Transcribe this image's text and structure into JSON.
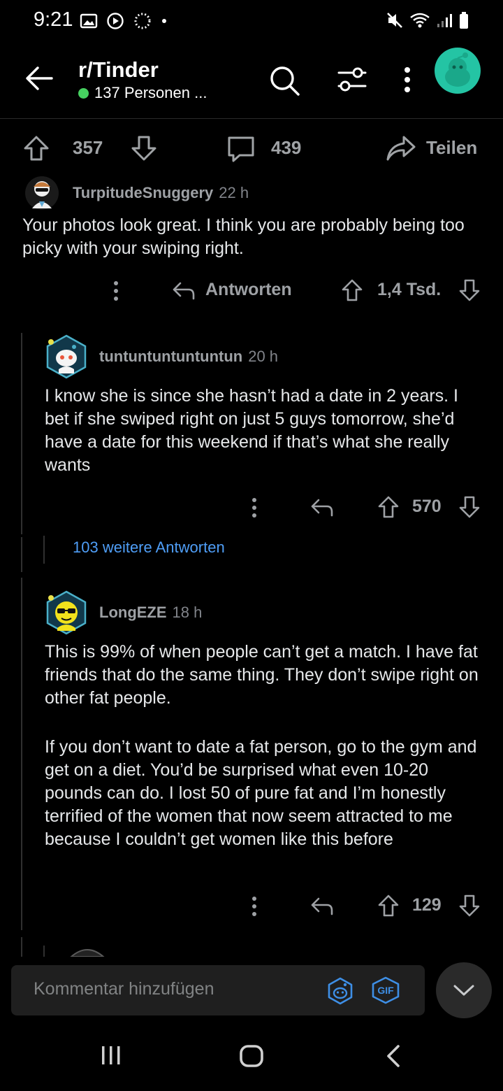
{
  "status": {
    "time": "9:21",
    "left_icons": [
      "image-icon",
      "play-icon",
      "spinner-icon",
      "dot-icon"
    ],
    "right_icons": [
      "mute-icon",
      "wifi-icon",
      "signal-icon",
      "battery-icon"
    ]
  },
  "header": {
    "title": "r/Tinder",
    "online_text": "137 Personen ...",
    "online_color": "#46d160",
    "avatar_color": "#24c4a4"
  },
  "post_bar": {
    "upvotes": "357",
    "comments": "439",
    "share_label": "Teilen"
  },
  "comments": [
    {
      "user": "TurpitudeSnuggery",
      "time": "22 h",
      "body": [
        "Your photos look great. I think you are probably being too picky with your swiping right."
      ],
      "reply_label": "Antworten",
      "score": "1,4 Tsd."
    },
    {
      "user": "tuntuntuntuntuntun",
      "time": "20 h",
      "body": [
        "I know she is since she hasn’t had a date in 2 years. I bet if she swiped right on just 5 guys tomorrow, she’d have a date for this weekend if that’s what she really wants"
      ],
      "score": "570"
    },
    {
      "user": "LongEZE",
      "time": "18 h",
      "body": [
        "This is 99% of when people can’t get a match. I have fat friends that do the same thing. They don’t swipe right on other fat people.",
        "If you don’t want to date a fat person, go to the gym and get on a diet. You’d be surprised what even 10-20 pounds can do. I lost 50 of pure fat and I’m honestly terrified of the women that now seem attracted to me because I couldn’t get women like this before"
      ],
      "score": "129"
    }
  ],
  "more_replies": "103 weitere Antworten",
  "composer": {
    "placeholder": "Kommentar hinzufügen",
    "gif_label": "GIF"
  },
  "colors": {
    "accent_link": "#4f9ef7",
    "snoo_blue": "#3e8fe6"
  }
}
